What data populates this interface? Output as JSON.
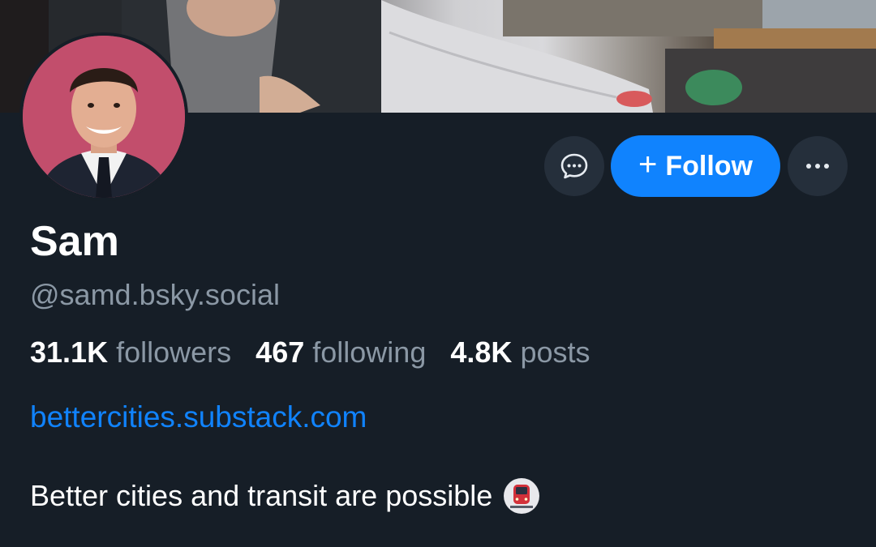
{
  "profile": {
    "display_name": "Sam",
    "handle": "@samd.bsky.social",
    "stats": [
      {
        "value": "31.1K",
        "label": "followers"
      },
      {
        "value": "467",
        "label": "following"
      },
      {
        "value": "4.8K",
        "label": "posts"
      }
    ],
    "website": "bettercities.substack.com",
    "bio": "Better cities and transit are possible",
    "bio_emoji": "metro-emoji"
  },
  "actions": {
    "message_icon": "chat-bubble-icon",
    "follow_label": "Follow",
    "follow_icon": "plus-icon",
    "more_icon": "ellipsis-icon"
  },
  "colors": {
    "background": "#161e27",
    "accent": "#1083fe",
    "muted_text": "#8b98a5",
    "button_bg": "#252f3b"
  }
}
